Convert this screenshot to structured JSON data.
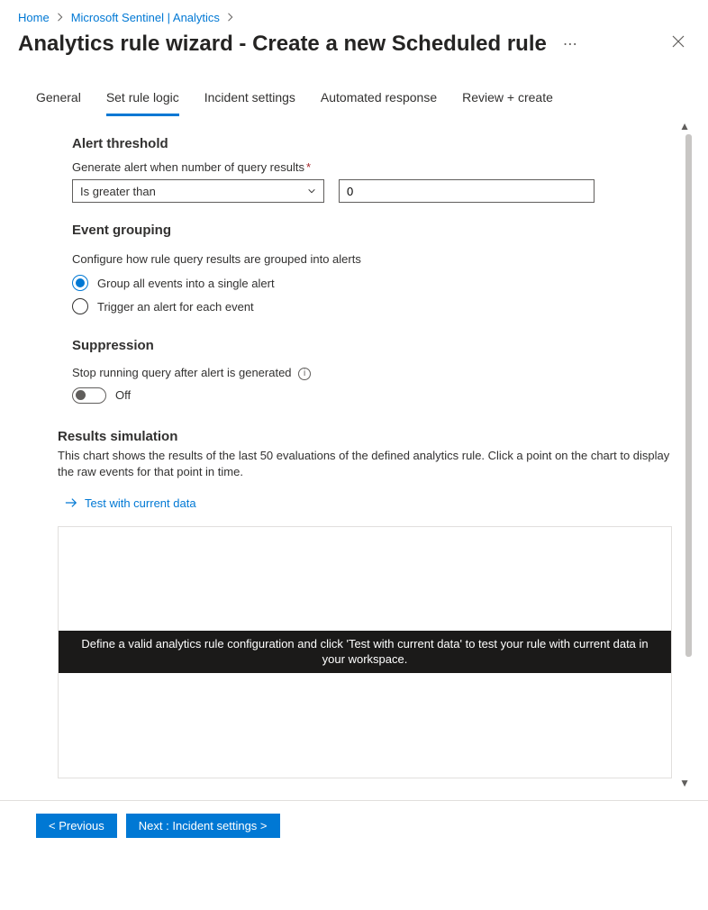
{
  "breadcrumb": {
    "home": "Home",
    "service": "Microsoft Sentinel | Analytics"
  },
  "title": "Analytics rule wizard - Create a new Scheduled rule",
  "tabs": {
    "general": "General",
    "set_rule_logic": "Set rule logic",
    "incident_settings": "Incident settings",
    "automated_response": "Automated response",
    "review_create": "Review + create"
  },
  "alert_threshold": {
    "heading": "Alert threshold",
    "label": "Generate alert when number of query results",
    "operator": "Is greater than",
    "value": "0"
  },
  "event_grouping": {
    "heading": "Event grouping",
    "desc": "Configure how rule query results are grouped into alerts",
    "opt1": "Group all events into a single alert",
    "opt2": "Trigger an alert for each event"
  },
  "suppression": {
    "heading": "Suppression",
    "label": "Stop running query after alert is generated",
    "state": "Off"
  },
  "results": {
    "heading": "Results simulation",
    "desc": "This chart shows the results of the last 50 evaluations of the defined analytics rule. Click a point on the chart to display the raw events for that point in time.",
    "test_link": "Test with current data",
    "placeholder": "Define a valid analytics rule configuration and click 'Test with current data' to test your rule with current data in your workspace."
  },
  "footer": {
    "prev": "< Previous",
    "next": "Next : Incident settings >"
  }
}
